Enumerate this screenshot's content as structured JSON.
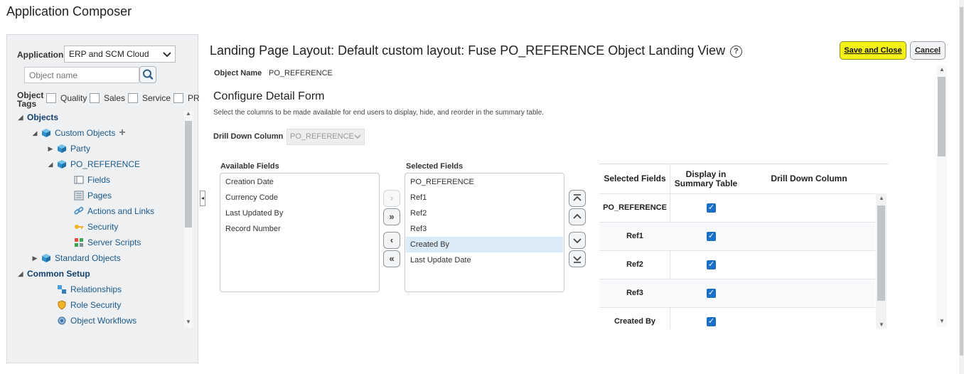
{
  "app_title": "Application Composer",
  "sidebar": {
    "application_label": "Application",
    "application_value": "ERP and SCM Cloud",
    "search_placeholder": "Object name",
    "tags_label": "Object Tags",
    "tags": [
      "Quality",
      "Sales",
      "Service",
      "PR"
    ],
    "tree": [
      {
        "label": "Objects",
        "indent": 0,
        "expand": "down",
        "header": true,
        "icon": "none"
      },
      {
        "label": "Custom Objects",
        "indent": 1,
        "expand": "down",
        "icon": "cube-icon",
        "extra": "plus-icon"
      },
      {
        "label": "Party",
        "indent": 2,
        "expand": "right",
        "icon": "cube-icon"
      },
      {
        "label": "PO_REFERENCE",
        "indent": 2,
        "expand": "down",
        "icon": "cube-icon"
      },
      {
        "label": "Fields",
        "indent": 3,
        "icon": "fields-icon"
      },
      {
        "label": "Pages",
        "indent": 3,
        "icon": "pages-icon"
      },
      {
        "label": "Actions and Links",
        "indent": 3,
        "icon": "link-icon"
      },
      {
        "label": "Security",
        "indent": 3,
        "icon": "key-icon"
      },
      {
        "label": "Server Scripts",
        "indent": 3,
        "icon": "scripts-icon"
      },
      {
        "label": "Standard Objects",
        "indent": 1,
        "expand": "right",
        "icon": "cube-icon"
      },
      {
        "label": "Common Setup",
        "indent": 0,
        "expand": "down",
        "header": true,
        "icon": "none"
      },
      {
        "label": "Relationships",
        "indent": 2,
        "icon": "relationships-icon"
      },
      {
        "label": "Role Security",
        "indent": 2,
        "icon": "shield-icon"
      },
      {
        "label": "Object Workflows",
        "indent": 2,
        "icon": "workflow-icon"
      }
    ]
  },
  "main": {
    "title": "Landing Page Layout: Default custom layout: Fuse PO_REFERENCE Object Landing View",
    "save_label": "Save and Close",
    "cancel_label": "Cancel",
    "object_name_label": "Object Name",
    "object_name_value": "PO_REFERENCE",
    "section_title": "Configure Detail Form",
    "section_desc": "Select the columns to be made available for end users to display, hide, and reorder in the summary table.",
    "drill_label": "Drill Down Column",
    "drill_value": "PO_REFERENCE",
    "available_label": "Available Fields",
    "available": [
      "Creation Date",
      "Currency Code",
      "Last Updated By",
      "Record Number"
    ],
    "selected_label": "Selected Fields",
    "selected": [
      "PO_REFERENCE",
      "Ref1",
      "Ref2",
      "Ref3",
      "Created By",
      "Last Update Date"
    ],
    "selected_highlight": 4,
    "table": {
      "headers": [
        "Selected Fields",
        "Display in Summary Table",
        "Drill Down Column"
      ],
      "rows": [
        {
          "field": "PO_REFERENCE",
          "display": true
        },
        {
          "field": "Ref1",
          "display": true
        },
        {
          "field": "Ref2",
          "display": true
        },
        {
          "field": "Ref3",
          "display": true
        },
        {
          "field": "Created By",
          "display": true
        }
      ]
    }
  }
}
